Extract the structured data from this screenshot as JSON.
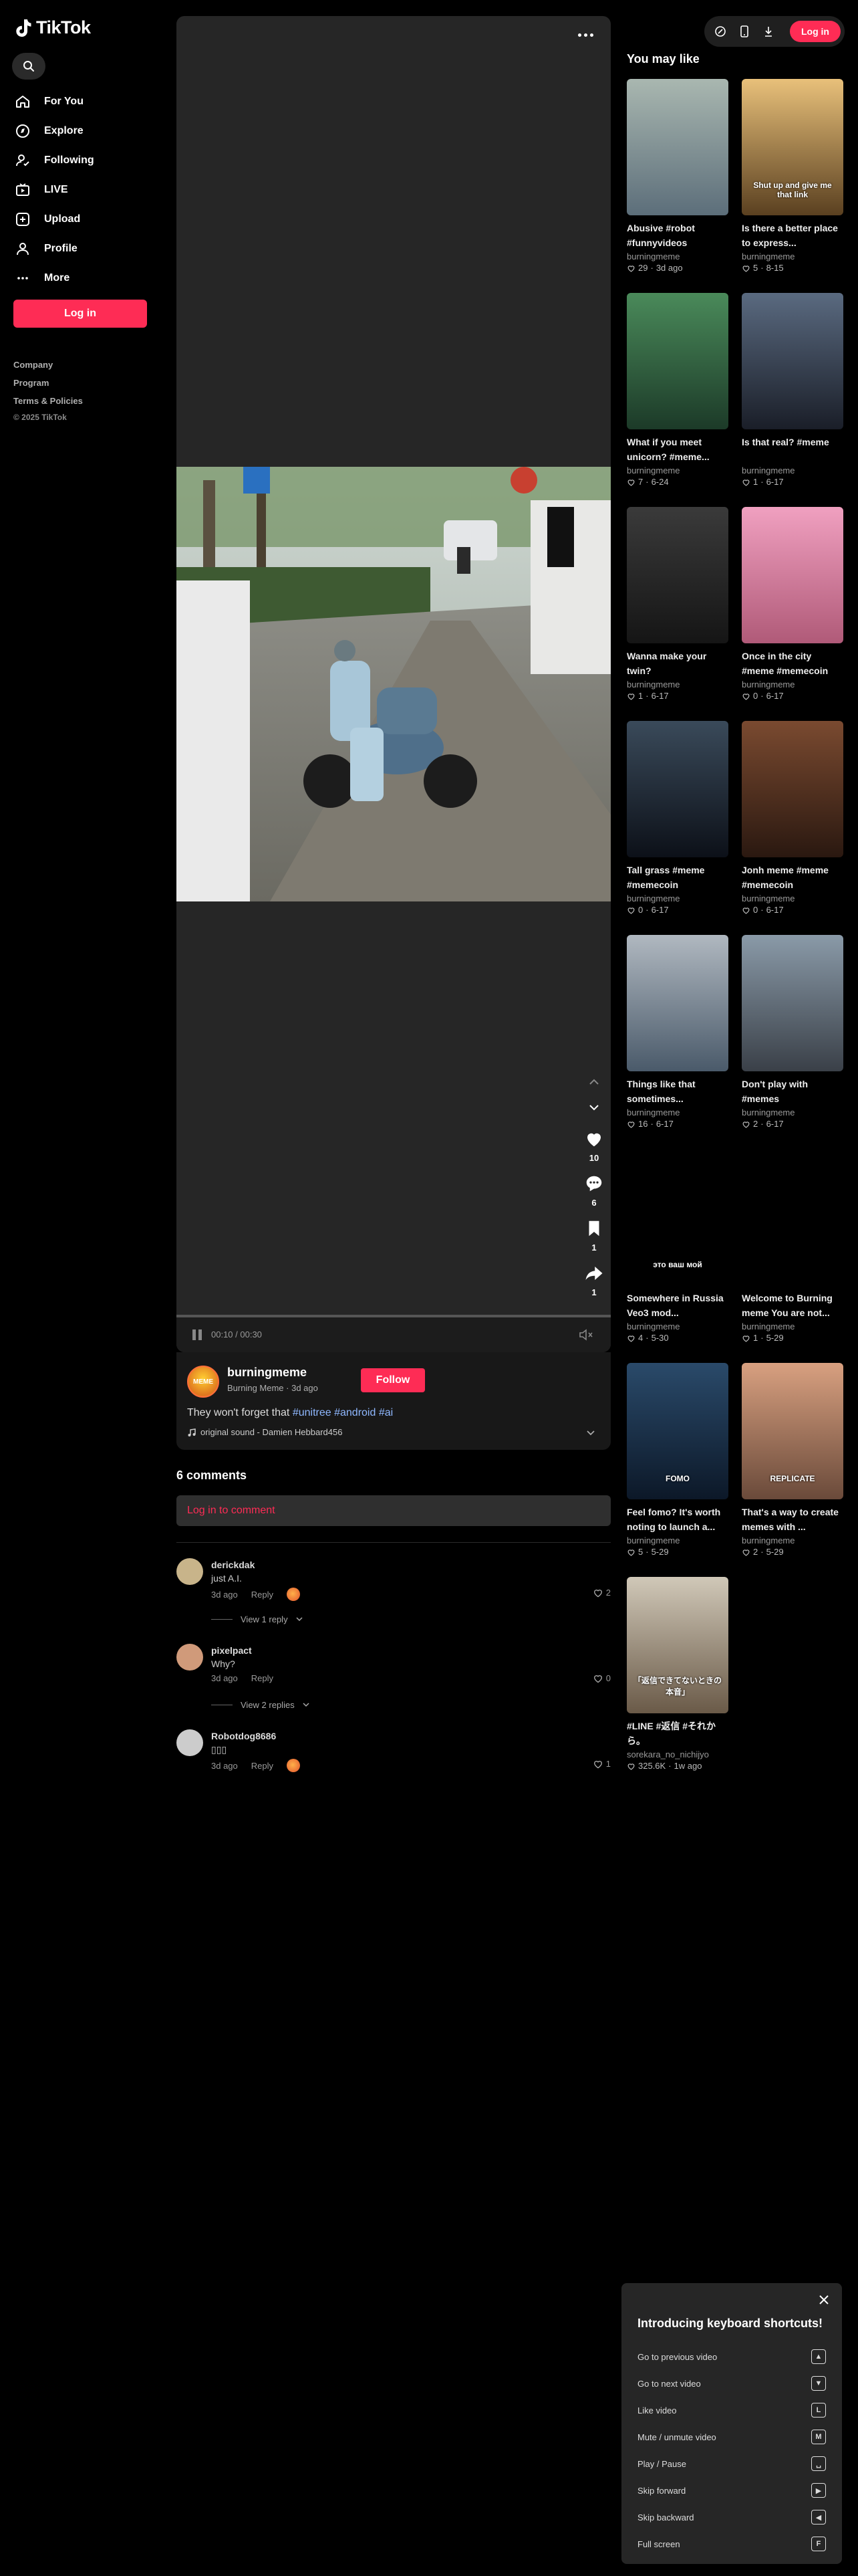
{
  "brand": {
    "name": "TikTok"
  },
  "sidebar": {
    "items": [
      {
        "label": "For You",
        "icon": "home-icon"
      },
      {
        "label": "Explore",
        "icon": "compass-icon"
      },
      {
        "label": "Following",
        "icon": "following-icon"
      },
      {
        "label": "LIVE",
        "icon": "live-icon"
      },
      {
        "label": "Upload",
        "icon": "upload-icon"
      },
      {
        "label": "Profile",
        "icon": "profile-icon"
      },
      {
        "label": "More",
        "icon": "more-icon"
      }
    ],
    "login_label": "Log in",
    "footer": [
      "Company",
      "Program",
      "Terms & Policies"
    ],
    "copyright": "© 2025 TikTok"
  },
  "player": {
    "time": "00:10 / 00:30",
    "likes": "10",
    "comments": "6",
    "saves": "1",
    "shares": "1"
  },
  "post": {
    "author": "burningmeme",
    "author_sub": "Burning Meme · 3d ago",
    "avatar_text": "MEME",
    "follow_label": "Follow",
    "caption_text": "They won't forget that",
    "tags": [
      "#unitree",
      "#android",
      "#ai"
    ],
    "sound": "original sound - Damien Hebbard456"
  },
  "comments": {
    "title": "6 comments",
    "login_prompt": "Log in to comment",
    "items": [
      {
        "user": "derickdak",
        "text": "just A.I.",
        "age": "3d ago",
        "reply_label": "Reply",
        "likes": "2",
        "view_replies": "View 1 reply",
        "avatar_color": "#c8b48a"
      },
      {
        "user": "pixelpact",
        "text": "Why?",
        "age": "3d ago",
        "reply_label": "Reply",
        "likes": "0",
        "view_replies": "View 2 replies",
        "avatar_color": "#d09a7a"
      },
      {
        "user": "Robotdog8686",
        "text": "",
        "age": "3d ago",
        "reply_label": "Reply",
        "likes": "1",
        "view_replies": "",
        "avatar_color": "#cccccc"
      }
    ]
  },
  "topbar": {
    "login_label": "Log in"
  },
  "recommendations": {
    "title": "You may like",
    "items": [
      {
        "title": "Abusive #robot #funnyvideos",
        "author": "burningmeme",
        "likes": "29",
        "date": "3d ago",
        "colors": [
          "#a9b7b0",
          "#5c6e7a"
        ]
      },
      {
        "title": "Is there a better place to express...",
        "author": "burningmeme",
        "likes": "5",
        "date": "8-15",
        "colors": [
          "#e8c07a",
          "#5a4020"
        ],
        "overlay": "Shut up and give me that link"
      },
      {
        "title": "What if you meet unicorn? #meme...",
        "author": "burningmeme",
        "likes": "7",
        "date": "6-24",
        "colors": [
          "#4a8a5a",
          "#1c3a28"
        ]
      },
      {
        "title": "Is that real? #meme",
        "author": "burningmeme",
        "likes": "1",
        "date": "6-17",
        "colors": [
          "#5a6a80",
          "#1a1e28"
        ]
      },
      {
        "title": "Wanna make your twin?",
        "author": "burningmeme",
        "likes": "1",
        "date": "6-17",
        "colors": [
          "#3a3a3a",
          "#151515"
        ]
      },
      {
        "title": "Once in the city #meme #memecoin",
        "author": "burningmeme",
        "likes": "0",
        "date": "6-17",
        "colors": [
          "#f0a0c0",
          "#b05a78"
        ]
      },
      {
        "title": "Tall grass #meme #memecoin",
        "author": "burningmeme",
        "likes": "0",
        "date": "6-17",
        "colors": [
          "#3a4a5a",
          "#0c1018"
        ]
      },
      {
        "title": "Jonh meme #meme #memecoin",
        "author": "burningmeme",
        "likes": "0",
        "date": "6-17",
        "colors": [
          "#7a4a30",
          "#2a1810"
        ]
      },
      {
        "title": "Things like that sometimes...",
        "author": "burningmeme",
        "likes": "16",
        "date": "6-17",
        "colors": [
          "#b0b8c0",
          "#4a5a6a"
        ]
      },
      {
        "title": "Don't play with #memes",
        "author": "burningmeme",
        "likes": "2",
        "date": "6-17",
        "colors": [
          "#8a9aa8",
          "#3a4048"
        ]
      },
      {
        "title": "Somewhere in Russia Veo3 mod...",
        "author": "burningmeme",
        "likes": "4",
        "date": "5-30",
        "colors": [
          "#000000",
          "#000000"
        ],
        "overlay": "это ваш мой"
      },
      {
        "title": "Welcome to Burning meme You are not...",
        "author": "burningmeme",
        "likes": "1",
        "date": "5-29",
        "colors": [
          "#000000",
          "#000000"
        ]
      },
      {
        "title": "Feel fomo? It's worth noting to launch a...",
        "author": "burningmeme",
        "likes": "5",
        "date": "5-29",
        "colors": [
          "#2a4a6a",
          "#0c1828"
        ],
        "overlay": "FOMO"
      },
      {
        "title": "That's a way to create memes with ...",
        "author": "burningmeme",
        "likes": "2",
        "date": "5-29",
        "colors": [
          "#d8a080",
          "#6a4a3a"
        ],
        "overlay": "REPLICATE"
      },
      {
        "title": "#LINE #返信 #それから。",
        "author": "sorekara_no_nichijyo",
        "likes": "325.6K",
        "date": "1w ago",
        "colors": [
          "#d0c8b8",
          "#6a5a48"
        ],
        "overlay": "「返信できてないときの本音」"
      }
    ]
  },
  "shortcuts": {
    "title": "Introducing keyboard shortcuts!",
    "items": [
      {
        "label": "Go to previous video",
        "key": "▲"
      },
      {
        "label": "Go to next video",
        "key": "▼"
      },
      {
        "label": "Like video",
        "key": "L"
      },
      {
        "label": "Mute / unmute video",
        "key": "M"
      },
      {
        "label": "Play / Pause",
        "key": "␣"
      },
      {
        "label": "Skip forward",
        "key": "▶"
      },
      {
        "label": "Skip backward",
        "key": "◀"
      },
      {
        "label": "Full screen",
        "key": "F"
      }
    ]
  },
  "colors": {
    "accent": "#fe2c55",
    "hashtag": "#8fb8ff",
    "panel": "#262626"
  }
}
